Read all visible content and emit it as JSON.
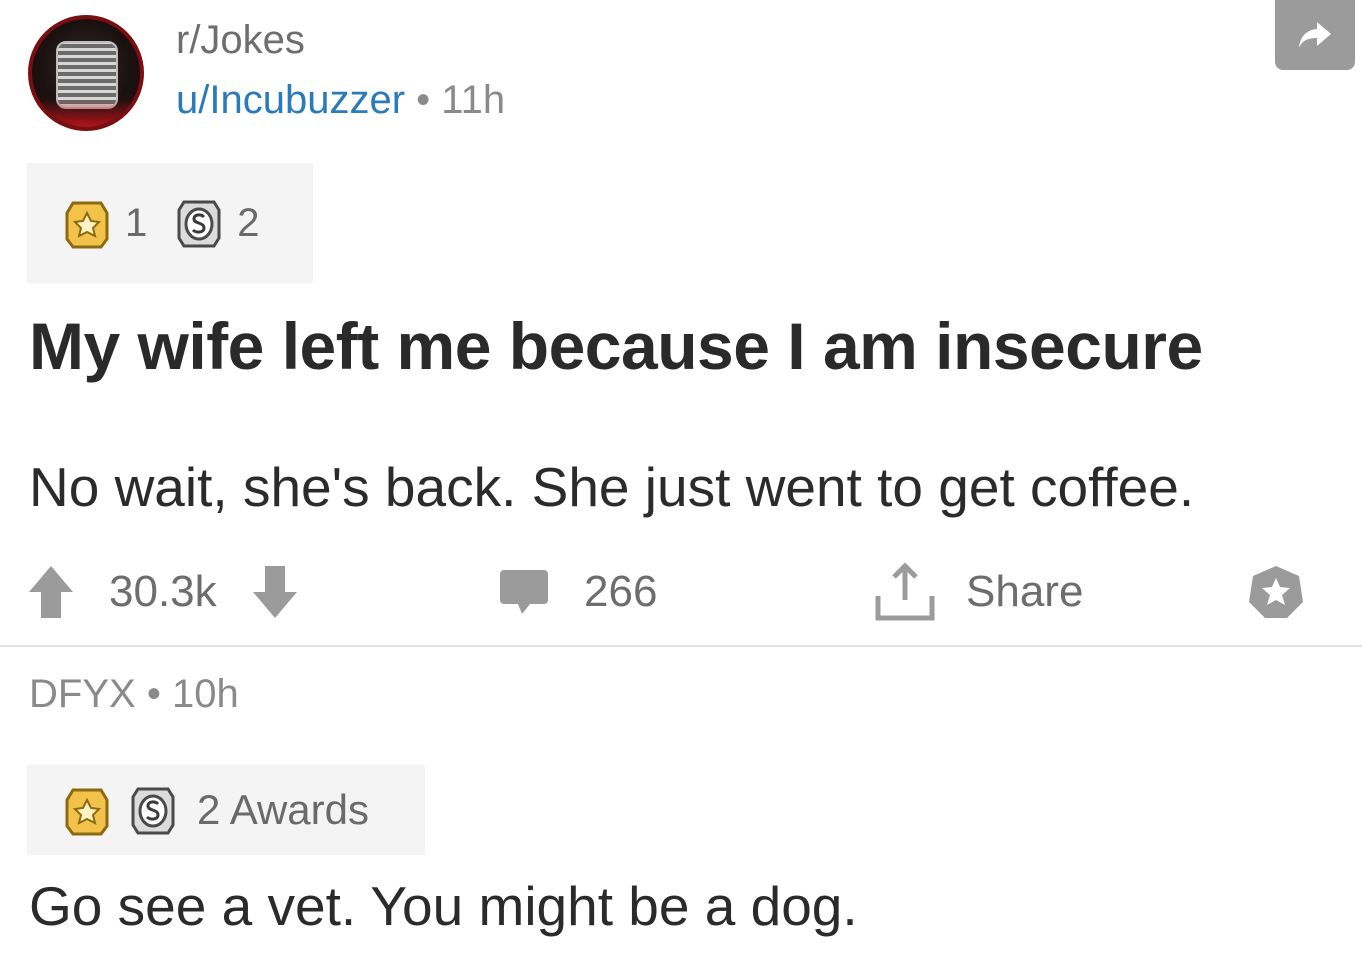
{
  "post": {
    "subreddit": "r/Jokes",
    "author": "u/Incubuzzer",
    "separator": "•",
    "age": "11h",
    "awards": {
      "gold_count": "1",
      "silver_count": "2"
    },
    "title": "My wife left me because I am insecure",
    "body": "No wait, she's back. She just went to get coffee."
  },
  "actions": {
    "score": "30.3k",
    "comments": "266",
    "share_label": "Share"
  },
  "comment": {
    "author": "DFYX",
    "separator": "•",
    "age": "10h",
    "awards_label": "2 Awards",
    "body": "Go see a vet. You might be a dog."
  },
  "colors": {
    "username_link": "#2b7bb9",
    "muted_text": "#8a8a8a",
    "icon_gray": "#9b9b9b",
    "award_gold": "#f2c24b",
    "subreddit_icon_ring": "#7a0f12"
  },
  "icons": {
    "share_corner": "share-arrow-icon",
    "gold": "gold-award-icon",
    "silver": "silver-award-icon",
    "upvote": "upvote-arrow-icon",
    "downvote": "downvote-arrow-icon",
    "comments": "comment-bubble-icon",
    "share": "share-upload-icon",
    "save": "save-star-icon"
  }
}
